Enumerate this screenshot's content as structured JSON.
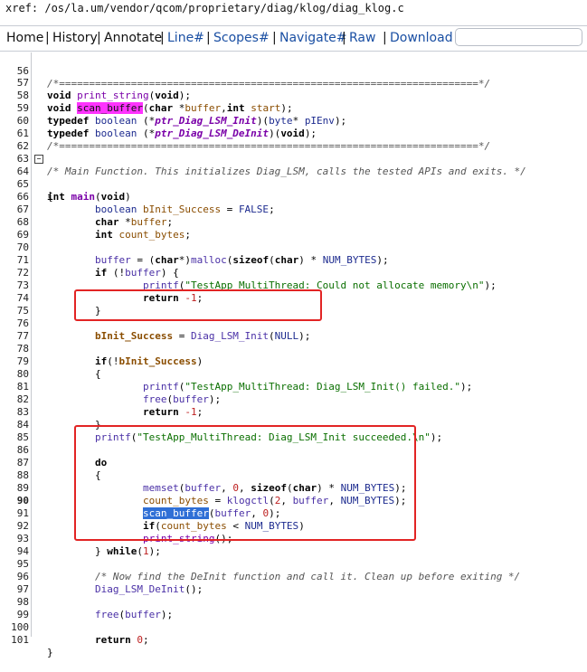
{
  "xref": "xref: /os/la.um/vendor/qcom/proprietary/diag/klog/diag_klog.c",
  "nav": {
    "home": "Home",
    "history": "History",
    "annotate": "Annotate",
    "line": "Line#",
    "scopes": "Scopes#",
    "navigate": "Navigate#",
    "raw": "Raw",
    "download": "Download",
    "search_value": ""
  },
  "lines": [
    {
      "n": "56",
      "text": "/*======================================================================*/"
    },
    {
      "n": "57",
      "text": "void print_string(void);"
    },
    {
      "n": "58",
      "text": "void scan_buffer(char *buffer,int start);"
    },
    {
      "n": "59",
      "text": "typedef boolean (*ptr_Diag_LSM_Init)(byte* pIEnv);"
    },
    {
      "n": "60",
      "text": "typedef boolean (*ptr_Diag_LSM_DeInit)(void);"
    },
    {
      "n": "61",
      "text": "/*======================================================================*/"
    },
    {
      "n": "62",
      "text": ""
    },
    {
      "n": "63",
      "text": "/* Main Function. This initializes Diag_LSM, calls the tested APIs and exits. */"
    },
    {
      "n": "64",
      "text": "int main(void)"
    },
    {
      "n": "65",
      "text": "{"
    },
    {
      "n": "66",
      "text": "        boolean bInit_Success = FALSE;"
    },
    {
      "n": "67",
      "text": "        char *buffer;"
    },
    {
      "n": "68",
      "text": "        int count_bytes;"
    },
    {
      "n": "69",
      "text": ""
    },
    {
      "n": "70",
      "text": "        buffer = (char*)malloc(sizeof(char) * NUM_BYTES);"
    },
    {
      "n": "71",
      "text": "        if (!buffer) {"
    },
    {
      "n": "72",
      "text": "                printf(\"TestApp_MultiThread: Could not allocate memory\\n\");"
    },
    {
      "n": "73",
      "text": "                return -1;"
    },
    {
      "n": "74",
      "text": "        }"
    },
    {
      "n": "75",
      "text": ""
    },
    {
      "n": "76",
      "text": "        bInit_Success = Diag_LSM_Init(NULL);"
    },
    {
      "n": "77",
      "text": ""
    },
    {
      "n": "78",
      "text": "        if(!bInit_Success)"
    },
    {
      "n": "79",
      "text": "        {"
    },
    {
      "n": "80",
      "text": "                printf(\"TestApp_MultiThread: Diag_LSM_Init() failed.\");"
    },
    {
      "n": "81",
      "text": "                free(buffer);"
    },
    {
      "n": "82",
      "text": "                return -1;"
    },
    {
      "n": "83",
      "text": "        }"
    },
    {
      "n": "84",
      "text": "        printf(\"TestApp_MultiThread: Diag_LSM_Init succeeded.\\n\");"
    },
    {
      "n": "85",
      "text": ""
    },
    {
      "n": "86",
      "text": "        do"
    },
    {
      "n": "87",
      "text": "        {"
    },
    {
      "n": "88",
      "text": "                memset(buffer, 0, sizeof(char) * NUM_BYTES);"
    },
    {
      "n": "89",
      "text": "                count_bytes = klogctl(2, buffer, NUM_BYTES);"
    },
    {
      "n": "90",
      "text": "                scan_buffer(buffer, 0);"
    },
    {
      "n": "91",
      "text": "                if(count_bytes < NUM_BYTES)"
    },
    {
      "n": "92",
      "text": "                print_string();"
    },
    {
      "n": "93",
      "text": "        } while(1);"
    },
    {
      "n": "94",
      "text": ""
    },
    {
      "n": "95",
      "text": "        /* Now find the DeInit function and call it. Clean up before exiting */"
    },
    {
      "n": "96",
      "text": "        Diag_LSM_DeInit();"
    },
    {
      "n": "97",
      "text": ""
    },
    {
      "n": "98",
      "text": "        free(buffer);"
    },
    {
      "n": "99",
      "text": ""
    },
    {
      "n": "100",
      "text": "        return 0;"
    },
    {
      "n": "101",
      "text": "}"
    }
  ],
  "colors": {
    "link": "#1a4fa3",
    "highlight_magenta": "#ff33ff",
    "highlight_blue": "#2f6fd6",
    "annotation_red": "#e22424"
  }
}
